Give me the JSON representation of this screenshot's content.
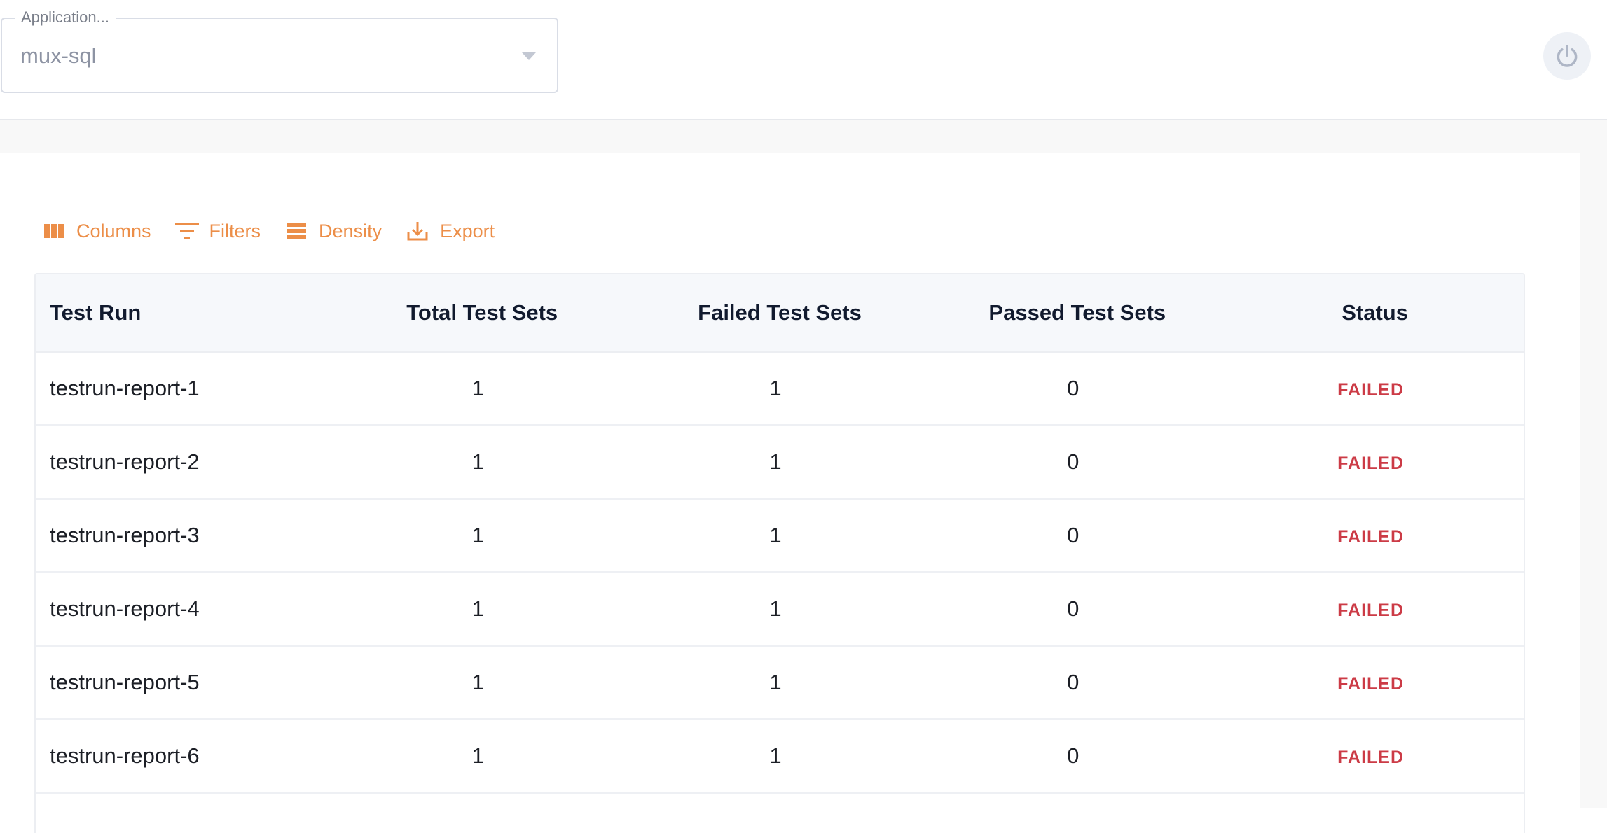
{
  "app_selector": {
    "label": "Application...",
    "value": "mux-sql"
  },
  "header": {
    "power_icon": "power-icon"
  },
  "toolbar": {
    "columns_label": "Columns",
    "filters_label": "Filters",
    "density_label": "Density",
    "export_label": "Export"
  },
  "colors": {
    "accent": "#ec8e48",
    "failed": "#cc3b46",
    "header_text": "#111a2e"
  },
  "table": {
    "headers": {
      "test_run": "Test Run",
      "total_test_sets": "Total Test Sets",
      "failed_test_sets": "Failed Test Sets",
      "passed_test_sets": "Passed Test Sets",
      "status": "Status"
    },
    "rows": [
      {
        "test_run": "testrun-report-1",
        "total": "1",
        "failed": "1",
        "passed": "0",
        "status": "FAILED"
      },
      {
        "test_run": "testrun-report-2",
        "total": "1",
        "failed": "1",
        "passed": "0",
        "status": "FAILED"
      },
      {
        "test_run": "testrun-report-3",
        "total": "1",
        "failed": "1",
        "passed": "0",
        "status": "FAILED"
      },
      {
        "test_run": "testrun-report-4",
        "total": "1",
        "failed": "1",
        "passed": "0",
        "status": "FAILED"
      },
      {
        "test_run": "testrun-report-5",
        "total": "1",
        "failed": "1",
        "passed": "0",
        "status": "FAILED"
      },
      {
        "test_run": "testrun-report-6",
        "total": "1",
        "failed": "1",
        "passed": "0",
        "status": "FAILED"
      }
    ]
  }
}
